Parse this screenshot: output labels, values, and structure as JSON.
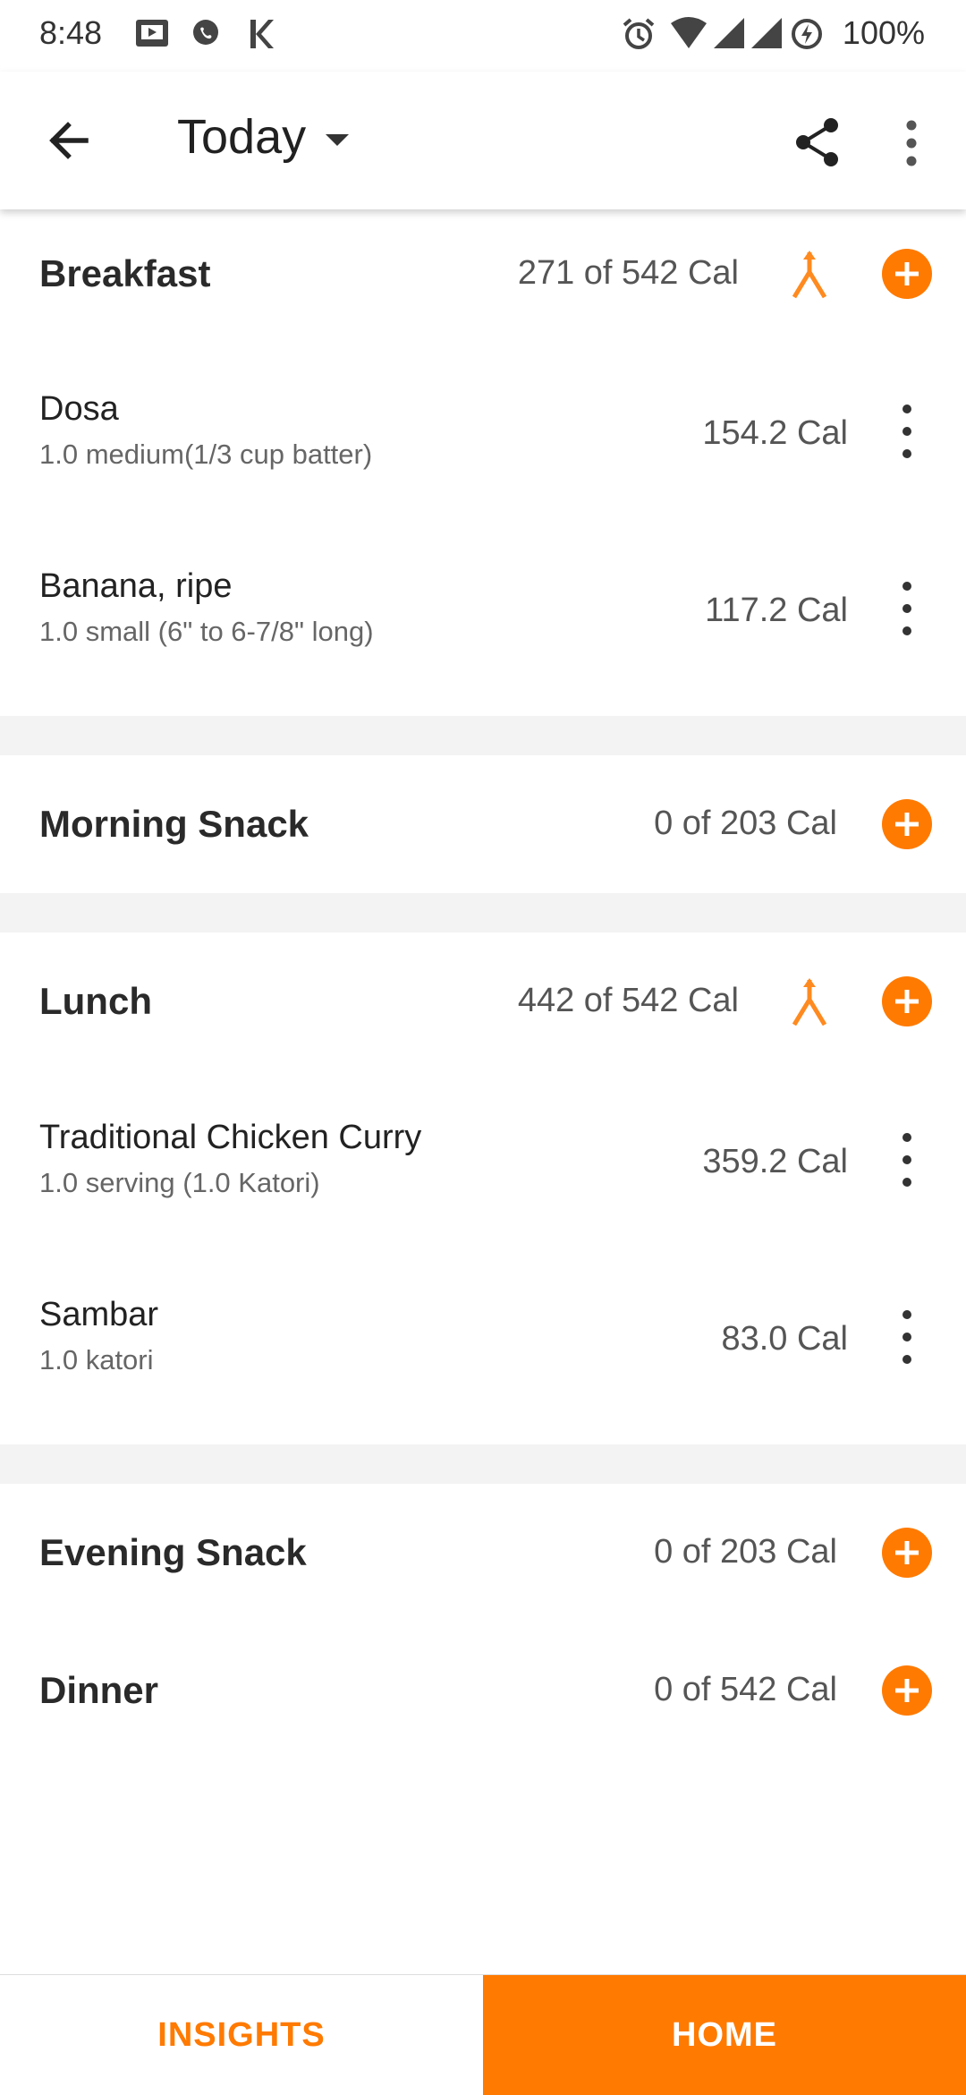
{
  "status_bar": {
    "time": "8:48",
    "battery": "100%",
    "icons": [
      "screen-icon",
      "phone-icon",
      "k-icon",
      "alarm-icon",
      "wifi-icon",
      "signal-icon",
      "signal-icon",
      "battery-saver-icon"
    ]
  },
  "app_bar": {
    "title": "Today",
    "icons": [
      "back-arrow-icon",
      "dropdown-arrow-icon",
      "share-icon",
      "more-vertical-icon"
    ]
  },
  "colors": {
    "accent": "#ff7a00",
    "section_gap": "#f3f3f3"
  },
  "meals": {
    "breakfast": {
      "title": "Breakfast",
      "calories": "271 of 542 Cal",
      "items": [
        {
          "name": "Dosa",
          "portion": "1.0 medium(1/3 cup batter)",
          "calories": "154.2 Cal"
        },
        {
          "name": "Banana, ripe",
          "portion": "1.0 small (6\" to 6-7/8\" long)",
          "calories": "117.2 Cal"
        }
      ]
    },
    "morning_snack": {
      "title": "Morning Snack",
      "calories": "0 of 203 Cal"
    },
    "lunch": {
      "title": "Lunch",
      "calories": "442 of 542 Cal",
      "items": [
        {
          "name": "Traditional Chicken Curry",
          "portion": "1.0 serving (1.0 Katori)",
          "calories": "359.2 Cal"
        },
        {
          "name": "Sambar",
          "portion": "1.0 katori",
          "calories": "83.0 Cal"
        }
      ]
    },
    "evening_snack": {
      "title": "Evening Snack",
      "calories": "0 of 203 Cal"
    },
    "dinner": {
      "title": "Dinner",
      "calories": "0 of 542 Cal"
    }
  },
  "bottom_nav": {
    "insights": "INSIGHTS",
    "home": "HOME"
  }
}
